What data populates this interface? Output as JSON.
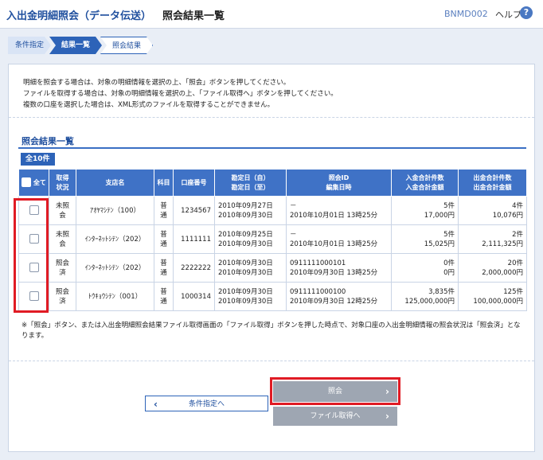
{
  "header": {
    "app_title": "入出金明細照会（データ伝送）",
    "page_title": "照会結果一覧",
    "screen_id": "BNMD002",
    "help_label": "ヘルプ",
    "help_icon": "question-circle-icon"
  },
  "steps": [
    {
      "label": "条件指定",
      "state": "done"
    },
    {
      "label": "結果一覧",
      "state": "current"
    },
    {
      "label": "照会結果",
      "state": "todo"
    }
  ],
  "instructions": [
    "明細を照会する場合は、対象の明細情報を選択の上、「照会」ボタンを押してください。",
    "ファイルを取得する場合は、対象の明細情報を選択の上、「ファイル取得へ」ボタンを押してください。",
    "複数の口座を選択した場合は、XML形式のファイルを取得することができません。"
  ],
  "results": {
    "section_title": "照会結果一覧",
    "count": "全10件",
    "headers": {
      "select_all": "全て",
      "status": [
        "取得",
        "状況"
      ],
      "branch": "支店名",
      "type": "科目",
      "account": "口座番号",
      "period": [
        "勘定日（自）",
        "勘定日（至）"
      ],
      "inquiry": [
        "照会ID",
        "編集日時"
      ],
      "deposit": [
        "入金合計件数",
        "入金合計金額"
      ],
      "withdraw": [
        "出金合計件数",
        "出金合計金額"
      ]
    },
    "rows": [
      {
        "status": "未照会",
        "branch": "ｱｵﾔﾏｼﾃﾝ（100）",
        "type": "普通",
        "account": "1234567",
        "period_from": "2010年09月27日",
        "period_to": "2010年09月30日",
        "inquiry_id": "－",
        "edited": "2010年10月01日 13時25分",
        "dep_count": "5件",
        "dep_amount": "17,000円",
        "wd_count": "4件",
        "wd_amount": "10,076円"
      },
      {
        "status": "未照会",
        "branch": "ｲﾝﾀｰﾈｯﾄｼﾃﾝ（202）",
        "type": "普通",
        "account": "1111111",
        "period_from": "2010年09月25日",
        "period_to": "2010年09月30日",
        "inquiry_id": "－",
        "edited": "2010年10月01日 13時25分",
        "dep_count": "5件",
        "dep_amount": "15,025円",
        "wd_count": "2件",
        "wd_amount": "2,111,325円"
      },
      {
        "status": "照会済",
        "branch": "ｲﾝﾀｰﾈｯﾄｼﾃﾝ（202）",
        "type": "普通",
        "account": "2222222",
        "period_from": "2010年09月30日",
        "period_to": "2010年09月30日",
        "inquiry_id": "0911111000101",
        "edited": "2010年09月30日 13時25分",
        "dep_count": "0件",
        "dep_amount": "0円",
        "wd_count": "20件",
        "wd_amount": "2,000,000円"
      },
      {
        "status": "照会済",
        "branch": "ﾄｳｷｮｳｼﾃﾝ（001）",
        "type": "普通",
        "account": "1000314",
        "period_from": "2010年09月30日",
        "period_to": "2010年09月30日",
        "inquiry_id": "0911111000100",
        "edited": "2010年09月30日 12時25分",
        "dep_count": "3,835件",
        "dep_amount": "125,000,000円",
        "wd_count": "125件",
        "wd_amount": "100,000,000円"
      }
    ]
  },
  "footnote": "※「照会」ボタン、または入出金明細照会結果ファイル取得画面の「ファイル取得」ボタンを押した時点で、対象口座の入出金明細情報の照会状況は「照会済」となります。",
  "buttons": {
    "back": "条件指定へ",
    "inquire": "照会",
    "file": "ファイル取得へ"
  },
  "colors": {
    "accent": "#2d63b8",
    "highlight": "#e01b24",
    "disabled_button": "#9ea6b2"
  }
}
